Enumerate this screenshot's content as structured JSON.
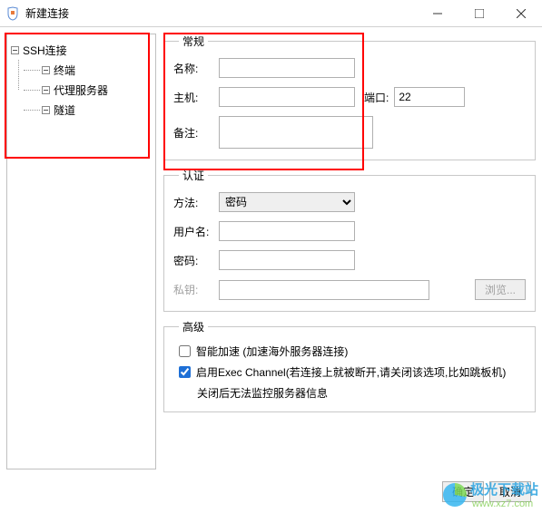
{
  "window": {
    "title": "新建连接",
    "icon_name": "java-duke-icon"
  },
  "tree": {
    "root": "SSH连接",
    "children": [
      "终端",
      "代理服务器",
      "隧道"
    ]
  },
  "general": {
    "legend": "常规",
    "name_label": "名称:",
    "name_value": "",
    "host_label": "主机:",
    "host_value": "",
    "port_label": "端口:",
    "port_value": "22",
    "remark_label": "备注:",
    "remark_value": ""
  },
  "auth": {
    "legend": "认证",
    "method_label": "方法:",
    "method_value": "密码",
    "method_options": [
      "密码"
    ],
    "user_label": "用户名:",
    "user_value": "",
    "password_label": "密码:",
    "password_value": "",
    "privkey_label": "私钥:",
    "privkey_value": "",
    "browse_label": "浏览..."
  },
  "advanced": {
    "legend": "高级",
    "smart_accel_label": "智能加速 (加速海外服务器连接)",
    "smart_accel_checked": false,
    "exec_channel_label": "启用Exec Channel(若连接上就被断开,请关闭该选项,比如跳板机)",
    "exec_channel_checked": true,
    "note": "关闭后无法监控服务器信息"
  },
  "buttons": {
    "ok": "确定",
    "cancel": "取消"
  },
  "watermark": {
    "title": "极光下载站",
    "sub": "www.xz7.com"
  }
}
